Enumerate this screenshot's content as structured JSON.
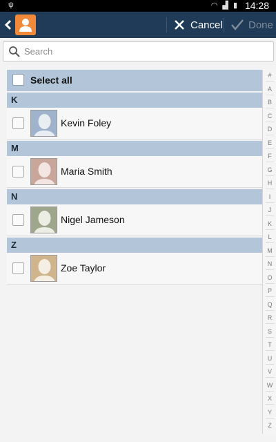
{
  "status_bar": {
    "time": "14:28"
  },
  "action_bar": {
    "cancel_label": "Cancel",
    "done_label": "Done"
  },
  "search": {
    "placeholder": "Search"
  },
  "select_all": {
    "label": "Select all"
  },
  "sections": [
    {
      "letter": "K",
      "contacts": [
        {
          "name": "Kevin Foley",
          "avatar_color": "#9fb3cc"
        }
      ]
    },
    {
      "letter": "M",
      "contacts": [
        {
          "name": "Maria Smith",
          "avatar_color": "#c9a59a"
        }
      ]
    },
    {
      "letter": "N",
      "contacts": [
        {
          "name": "Nigel Jameson",
          "avatar_color": "#9ea68c"
        }
      ]
    },
    {
      "letter": "Z",
      "contacts": [
        {
          "name": "Zoe Taylor",
          "avatar_color": "#cfb48c"
        }
      ]
    }
  ],
  "index_letters": [
    "#",
    "A",
    "B",
    "C",
    "D",
    "E",
    "F",
    "G",
    "H",
    "I",
    "J",
    "K",
    "L",
    "M",
    "N",
    "O",
    "P",
    "Q",
    "R",
    "S",
    "T",
    "U",
    "V",
    "W",
    "X",
    "Y",
    "Z"
  ],
  "colors": {
    "action_bar": "#1f3b57",
    "section_header": "#b3c5d8",
    "app_icon": "#f08a3a"
  }
}
